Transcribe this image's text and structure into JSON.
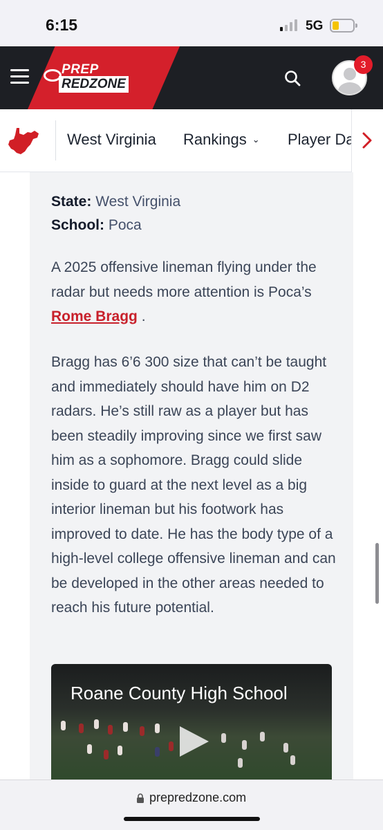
{
  "status_bar": {
    "time": "6:15",
    "network": "5G",
    "signal_bars_active": 1,
    "battery_level": 0.2,
    "battery_color": "#f4c300"
  },
  "header": {
    "menu_icon": "hamburger-icon",
    "logo": {
      "line1": "PREP",
      "line2": "REDZONE"
    },
    "search_icon": "search-icon",
    "avatar_icon": "user-avatar-icon",
    "notification_count": "3",
    "brand_red": "#d4202b",
    "header_bg": "#1d1f24"
  },
  "state_nav": {
    "state_icon": "west-virginia-map-icon",
    "items": [
      {
        "label": "West Virginia"
      },
      {
        "label": "Rankings",
        "icon": "chevron-down-icon"
      },
      {
        "label": "Player Da"
      }
    ],
    "scroll_arrow_icon": "chevron-right-icon"
  },
  "article": {
    "state_label": "State:",
    "state_value": " West Virginia",
    "school_label": "School:",
    "school_value": " Poca",
    "para1_before": "A 2025 offensive lineman flying under the radar but needs more attention is Poca’s ",
    "para1_link": "Rome Bragg",
    "para1_after": " .",
    "para2": "Bragg has 6’6 300 size that can’t be taught and immediately should have him on D2 radars. He’s still raw as a player but has been steadily improving since we first saw him as a sophomore. Bragg could slide inside to guard at the next level as a big interior lineman but his footwork has improved to date. He has the body type of a high-level college offensive lineman and can be developed in the other areas needed to reach his future potential."
  },
  "video": {
    "title": "Roane County High School",
    "play_icon": "play-icon"
  },
  "browser": {
    "lock_icon": "lock-icon",
    "url": "prepredzone.com"
  }
}
